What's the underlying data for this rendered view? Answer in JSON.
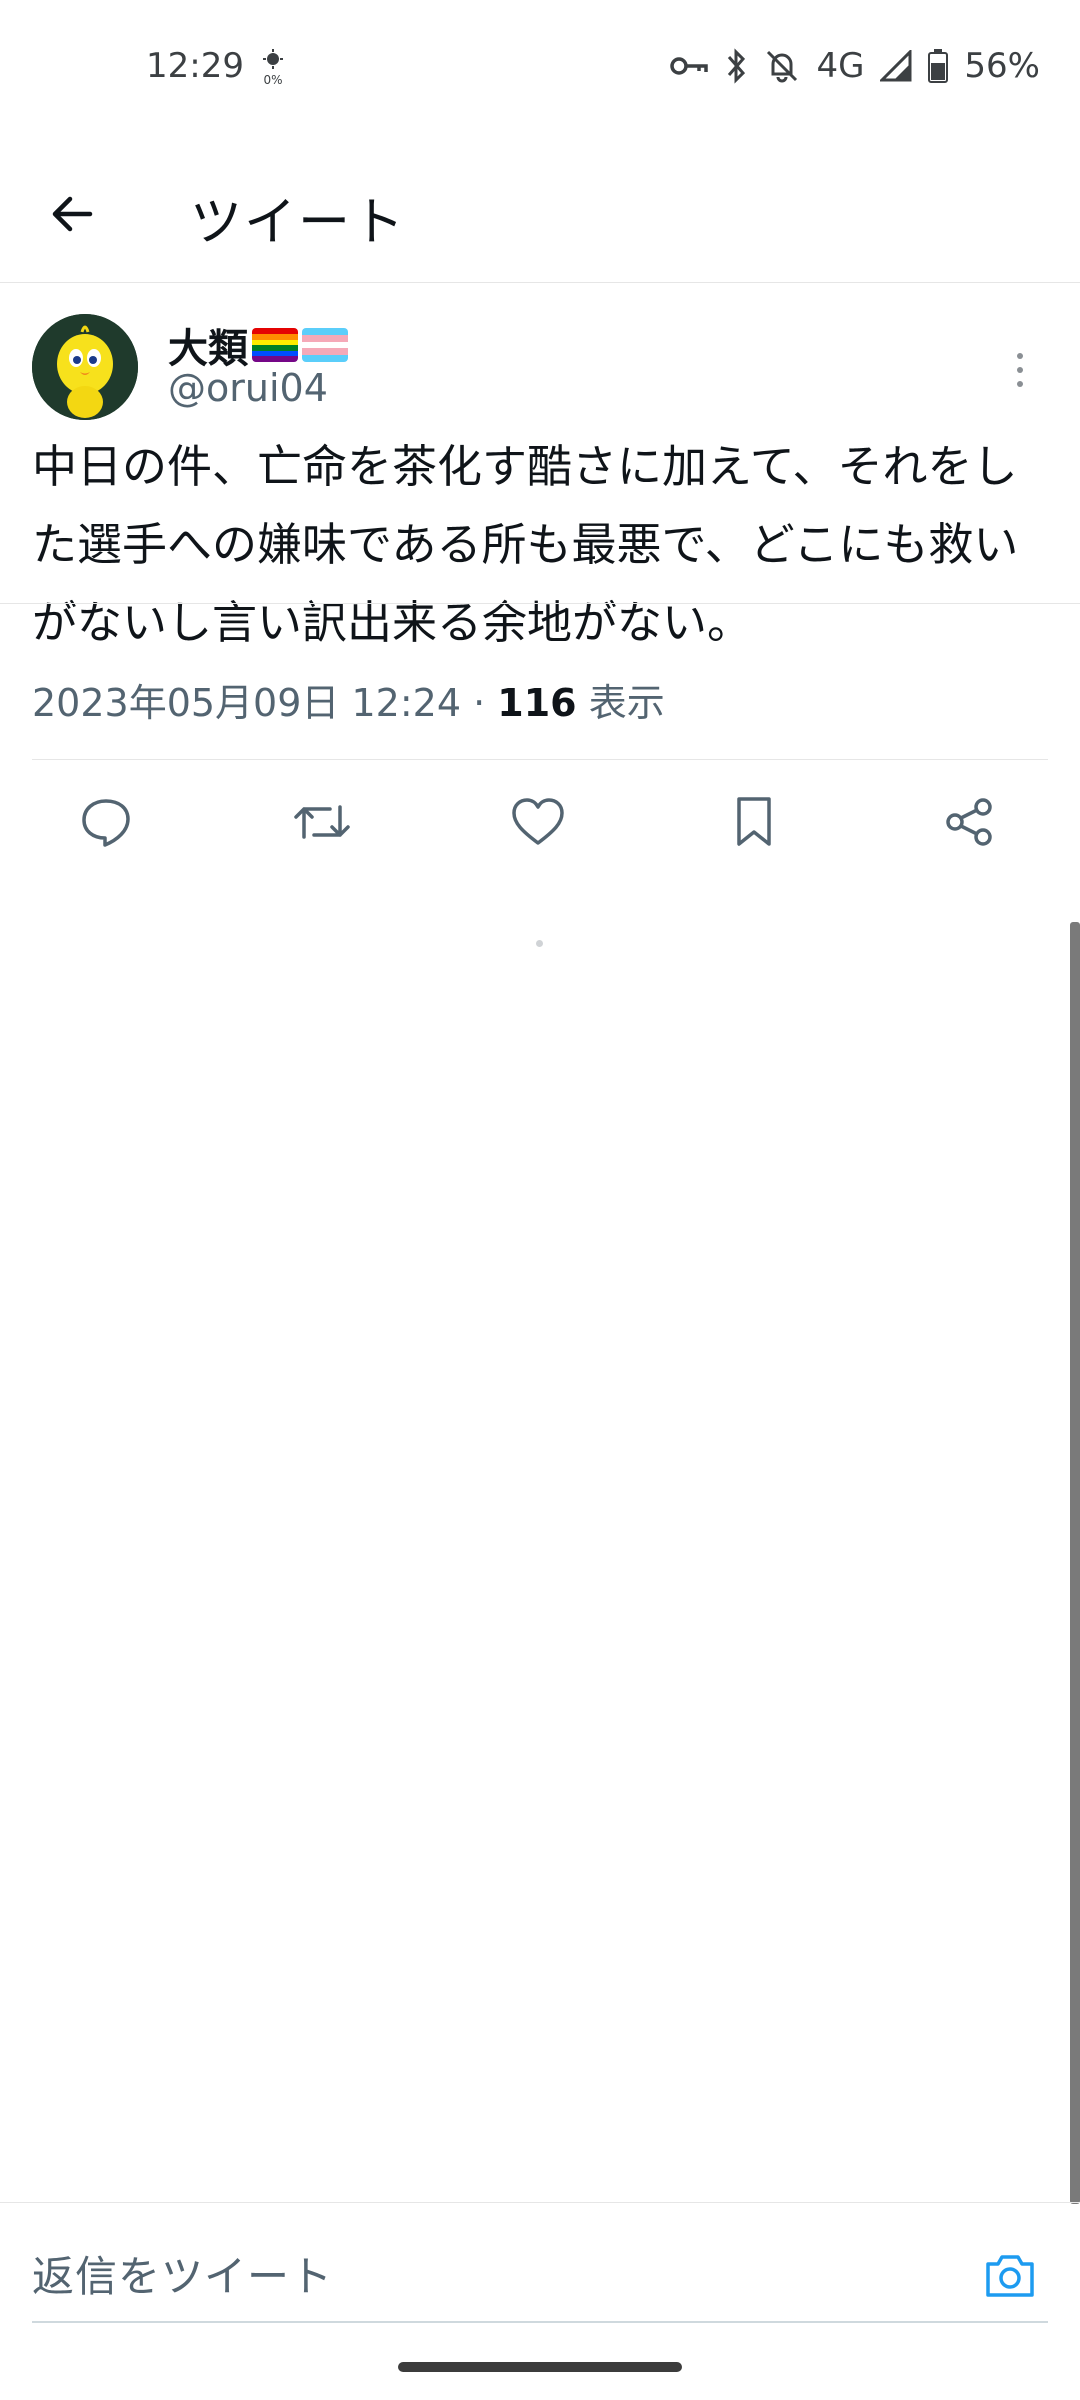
{
  "status_bar": {
    "time": "12:29",
    "sensor_label": "0%",
    "network": "4G",
    "battery": "56%",
    "icons": [
      "vpn-key-icon",
      "bluetooth-icon",
      "notifications-off-icon",
      "signal-icon",
      "battery-icon"
    ]
  },
  "app_bar": {
    "title": "ツイート",
    "back_icon": "arrow-left-icon"
  },
  "tweet": {
    "display_name": "大類",
    "name_emojis": [
      "rainbow-flag",
      "transgender-flag"
    ],
    "handle": "@orui04",
    "text": "中日の件、亡命を茶化す酷さに加えて、それをした選手への嫌味である所も最悪で、どこにも救いがないし言い訳出来る余地がない。",
    "timestamp": "2023年05月09日 12:24",
    "separator": "·",
    "views_count": "116",
    "views_label": "表示"
  },
  "actions": [
    {
      "name": "reply",
      "icon": "comment-icon"
    },
    {
      "name": "retweet",
      "icon": "retweet-icon"
    },
    {
      "name": "like",
      "icon": "heart-icon"
    },
    {
      "name": "bookmark",
      "icon": "bookmark-icon"
    },
    {
      "name": "share",
      "icon": "share-icon"
    }
  ],
  "reply_box": {
    "placeholder": "返信をツイート",
    "camera_icon": "camera-icon"
  },
  "colors": {
    "text_primary": "#0f1419",
    "text_secondary": "#536471",
    "accent": "#1d9bf0",
    "divider": "#e6e6e6"
  }
}
